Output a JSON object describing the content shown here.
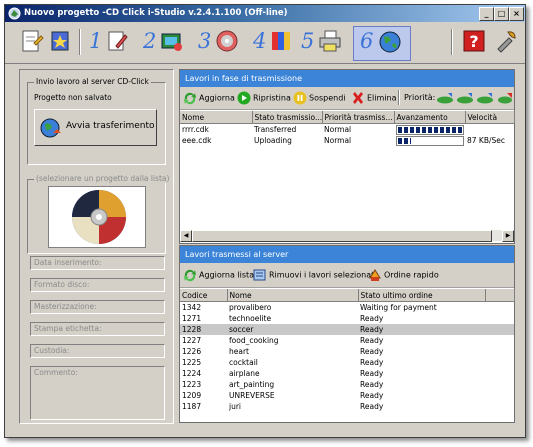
{
  "window": {
    "title": "Nuovo progetto -CD Click i-Studio v.2.4.1.100 (Off-line)",
    "controls": [
      "_",
      "□",
      "×"
    ]
  },
  "toolbar": {
    "steps": [
      {
        "number": "1",
        "icon": "edit-icon"
      },
      {
        "number": "2",
        "icon": "film-reel-icon"
      },
      {
        "number": "3",
        "icon": "disc-icon"
      },
      {
        "number": "4",
        "icon": "color-palette-icon"
      },
      {
        "number": "5",
        "icon": "print-icon"
      },
      {
        "number": "6",
        "icon": "globe-icon"
      }
    ],
    "selected_step": "6",
    "help_icon": "help-icon",
    "settings_icon": "tools-icon"
  },
  "left": {
    "group_title": "Invio lavoro al server CD-Click",
    "project_status": "Progetto non salvato",
    "send_button": "Avvia trasferimento",
    "select_group_title": "(selezionare un progetto dalla lista)",
    "fields": [
      "Data inserimento:",
      "Formato disco:",
      "Masterizzazione:",
      "Stampa etichetta:",
      "Custodia:",
      "Commento:"
    ]
  },
  "transmission": {
    "title": "Lavori in fase di trasmissione",
    "buttons": {
      "update": "Aggiorna",
      "resume": "Ripristina",
      "suspend": "Sospendi",
      "delete": "Elimina",
      "priority": "Priorità:"
    },
    "columns": [
      "Nome",
      "Stato trasmissio...",
      "Priorità trasmiss...",
      "Avanzamento",
      "Velocità"
    ],
    "rows": [
      {
        "name": "rrrr.cdk",
        "status": "Transferred",
        "priority": "Normal",
        "progress": 1.0,
        "speed": ""
      },
      {
        "name": "eee.cdk",
        "status": "Uploading",
        "priority": "Normal",
        "progress": 0.2,
        "speed": "87 KB/Sec"
      }
    ]
  },
  "transmitted": {
    "title": "Lavori trasmessi al server",
    "buttons": {
      "refresh": "Aggiorna lista",
      "remove": "Rimuovi i lavori selezionati",
      "quick_order": "Ordine rapido"
    },
    "columns": [
      "Codice",
      "Nome",
      "Stato ultimo ordine"
    ],
    "rows": [
      {
        "code": "1342",
        "name": "provalibero",
        "status": "Waiting for payment"
      },
      {
        "code": "1271",
        "name": "technoelite",
        "status": "Ready"
      },
      {
        "code": "1228",
        "name": "soccer",
        "status": "Ready"
      },
      {
        "code": "1227",
        "name": "food_cooking",
        "status": "Ready"
      },
      {
        "code": "1226",
        "name": "heart",
        "status": "Ready"
      },
      {
        "code": "1225",
        "name": "cocktail",
        "status": "Ready"
      },
      {
        "code": "1224",
        "name": "airplane",
        "status": "Ready"
      },
      {
        "code": "1223",
        "name": "art_painting",
        "status": "Ready"
      },
      {
        "code": "1209",
        "name": "UNREVERSE",
        "status": "Ready"
      },
      {
        "code": "1187",
        "name": "juri",
        "status": "Ready"
      }
    ],
    "selected_code": "1228"
  },
  "colors": {
    "panel_header": "#3c84d8",
    "title_bar": "#0a246a",
    "progress": "#0a246a"
  }
}
